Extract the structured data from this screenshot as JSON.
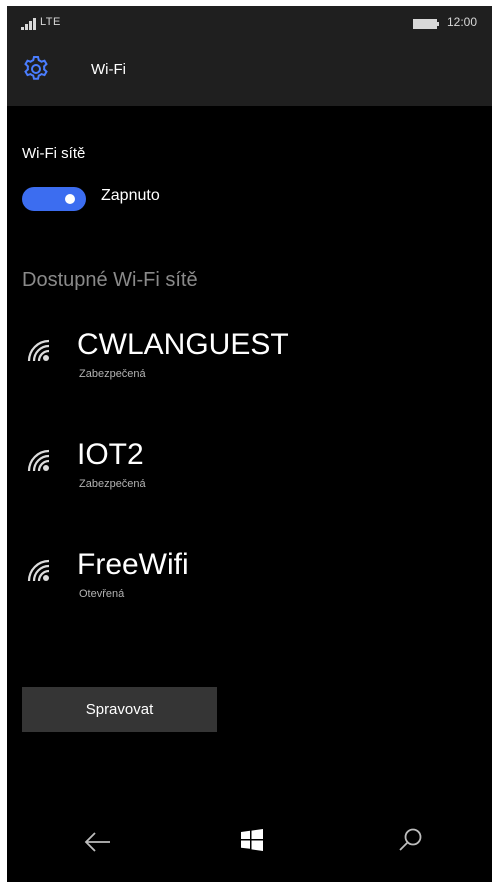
{
  "status_bar": {
    "network": "LTE",
    "time": "12:00"
  },
  "header": {
    "title": "Wi-Fi",
    "icon": "gear-icon"
  },
  "wifi_section": {
    "label": "Wi-Fi sítě",
    "toggle_state": "Zapnuto",
    "toggle_on": true,
    "accent_color": "#3c6df0"
  },
  "available": {
    "heading": "Dostupné Wi-Fi sítě",
    "networks": [
      {
        "name": "CWLANGUEST",
        "status": "Zabezpečená",
        "icon": "wifi-signal-icon"
      },
      {
        "name": "IOT2",
        "status": "Zabezpečená",
        "icon": "wifi-signal-icon"
      },
      {
        "name": "FreeWifi",
        "status": "Otevřená",
        "icon": "wifi-signal-icon"
      }
    ]
  },
  "actions": {
    "manage_label": "Spravovat"
  },
  "nav": {
    "icons": [
      "back-arrow-icon",
      "windows-logo-icon",
      "search-icon"
    ]
  }
}
